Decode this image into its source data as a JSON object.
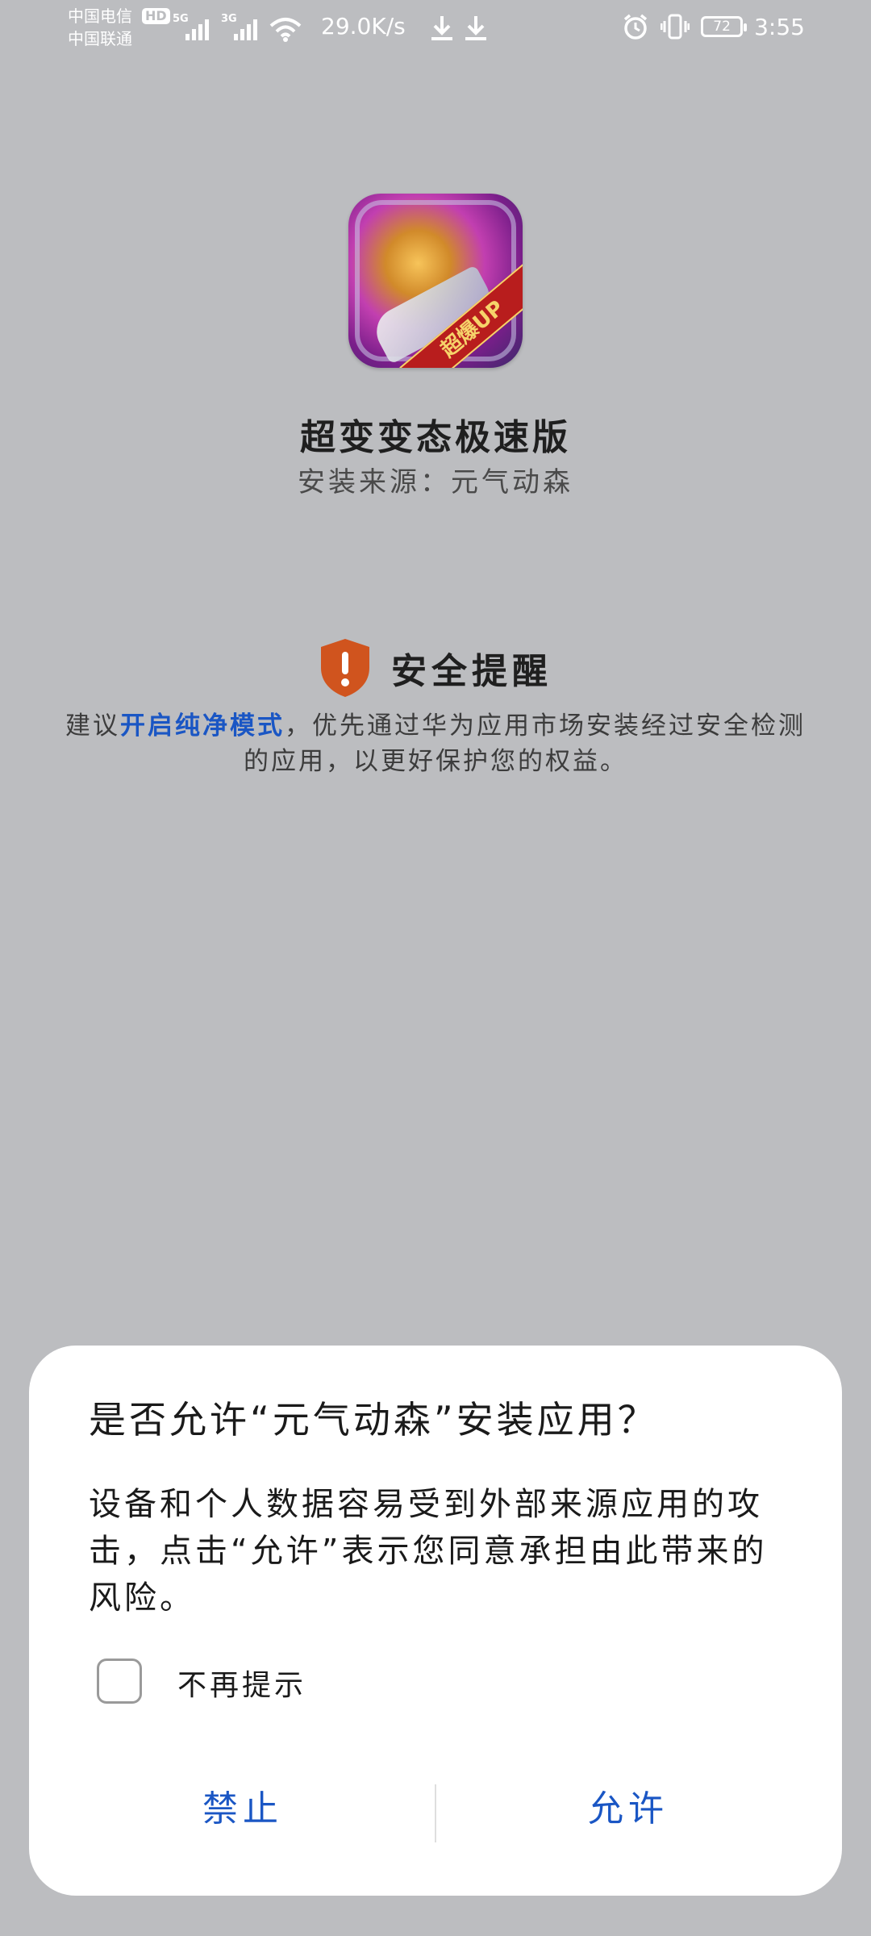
{
  "status_bar": {
    "carrier1": "中国电信",
    "carrier2": "中国联通",
    "hd_badge": "HD",
    "sim1_network": "5G",
    "sim2_network": "3G",
    "net_speed": "29.0K/s",
    "battery": "72",
    "time": "3:55"
  },
  "app": {
    "name": "超变变态极速版",
    "install_source": "安装来源：元气动森",
    "icon_badge": "超爆UP"
  },
  "security": {
    "title": "安全提醒",
    "desc_prefix": "建议",
    "desc_link": "开启纯净模式",
    "desc_suffix": "，优先通过华为应用市场安装经过安全检测的应用，以更好保护您的权益。"
  },
  "dialog": {
    "title": "是否允许“元气动森”安装应用？",
    "message": "设备和个人数据容易受到外部来源应用的攻击，点击“允许”表示您同意承担由此带来的风险。",
    "checkbox_label": "不再提示",
    "checkbox_checked": false,
    "deny_label": "禁止",
    "allow_label": "允许"
  },
  "colors": {
    "background": "#bcbdc0",
    "accent": "#1a56c4",
    "shield": "#d0541e"
  }
}
